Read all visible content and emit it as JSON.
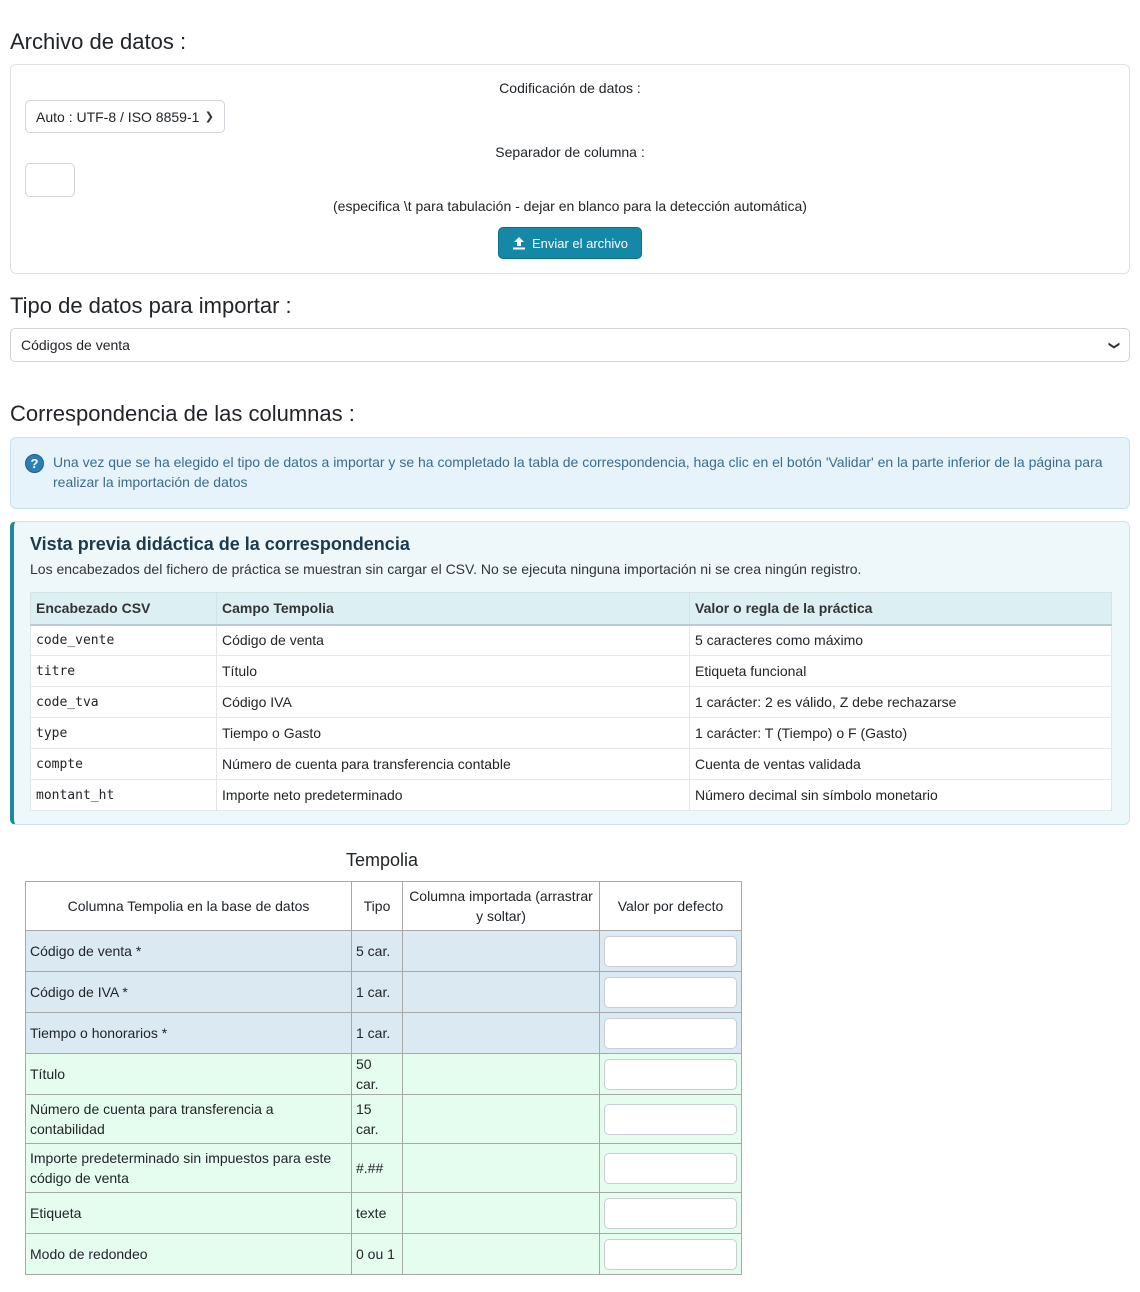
{
  "archivo": {
    "title": "Archivo de datos :",
    "encoding_label": "Codificación de datos :",
    "encoding_value": "Auto : UTF-8 / ISO 8859-1",
    "separator_label": "Separador de columna :",
    "separator_hint": "(especifica \\t para tabulación - dejar en blanco para la detección automática)",
    "upload_button": "Enviar el archivo"
  },
  "tipo": {
    "title": "Tipo de datos para importar :",
    "value": "Códigos de venta"
  },
  "correspondencia": {
    "title": "Correspondencia de las columnas :",
    "info": "Una vez que se ha elegido el tipo de datos a importar y se ha completado la tabla de correspondencia, haga clic en el botón 'Validar' en la parte inferior de la página para realizar la importación de datos"
  },
  "preview": {
    "title": "Vista previa didáctica de la correspondencia",
    "subtitle": "Los encabezados del fichero de práctica se muestran sin cargar el CSV. No se ejecuta ninguna importación ni se crea ningún registro.",
    "headers": [
      "Encabezado CSV",
      "Campo Tempolia",
      "Valor o regla de la práctica"
    ],
    "rows": [
      [
        "code_vente",
        "Código de venta",
        "5 caracteres como máximo"
      ],
      [
        "titre",
        "Título",
        "Etiqueta funcional"
      ],
      [
        "code_tva",
        "Código IVA",
        "1 carácter: 2 es válido, Z debe rechazarse"
      ],
      [
        "type",
        "Tiempo o Gasto",
        "1 carácter: T (Tiempo) o F (Gasto)"
      ],
      [
        "compte",
        "Número de cuenta para transferencia contable",
        "Cuenta de ventas validada"
      ],
      [
        "montant_ht",
        "Importe neto predeterminado",
        "Número decimal sin símbolo monetario"
      ]
    ]
  },
  "mapping": {
    "title": "Tempolia",
    "headers": [
      "Columna Tempolia en la base de datos",
      "Tipo",
      "Columna importada (arrastrar y soltar)",
      "Valor por defecto"
    ],
    "rows": [
      {
        "label": "Código de venta *",
        "type": "5 car.",
        "required": true
      },
      {
        "label": "Código de IVA *",
        "type": "1 car.",
        "required": true
      },
      {
        "label": "Tiempo o honorarios *",
        "type": "1 car.",
        "required": true
      },
      {
        "label": "Título",
        "type": "50 car.",
        "required": false
      },
      {
        "label": "Número de cuenta para transferencia a contabilidad",
        "type": "15 car.",
        "required": false
      },
      {
        "label": "Importe predeterminado sin impuestos para este código de venta",
        "type": "#.##",
        "required": false
      },
      {
        "label": "Etiqueta",
        "type": "texte",
        "required": false
      },
      {
        "label": "Modo de redondeo",
        "type": "0 ou 1",
        "required": false
      }
    ]
  }
}
